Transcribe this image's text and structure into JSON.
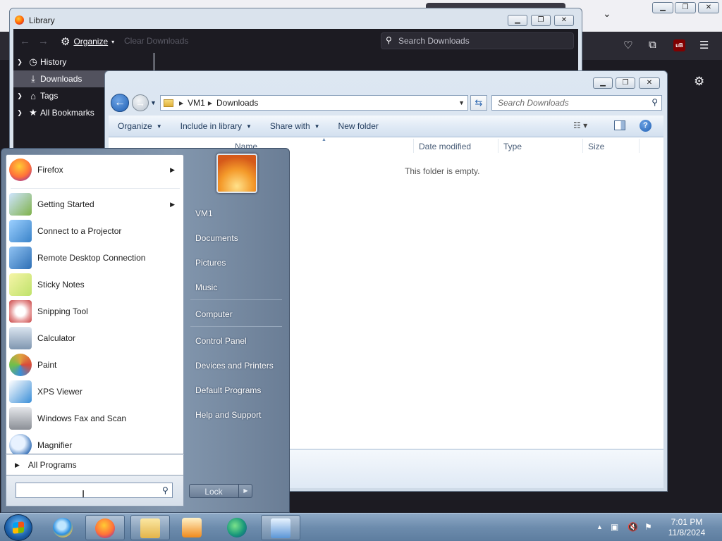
{
  "library": {
    "title": "Library",
    "organize": "Organize",
    "clear_downloads": "Clear Downloads",
    "search_placeholder": "Search Downloads",
    "sidebar": [
      {
        "label": "History",
        "icon": "clock-icon",
        "twisty": "›",
        "selected": false
      },
      {
        "label": "Downloads",
        "icon": "download-icon",
        "twisty": "",
        "selected": true
      },
      {
        "label": "Tags",
        "icon": "tag-icon",
        "twisty": "›",
        "selected": false
      },
      {
        "label": "All Bookmarks",
        "icon": "star-icon",
        "twisty": "›",
        "selected": false
      }
    ]
  },
  "explorer": {
    "address": {
      "root": "VM1",
      "folder": "Downloads"
    },
    "search_placeholder": "Search Downloads",
    "commands": [
      {
        "label": "Organize",
        "dropdown": true
      },
      {
        "label": "Include in library",
        "dropdown": true
      },
      {
        "label": "Share with",
        "dropdown": true
      },
      {
        "label": "New folder",
        "dropdown": false
      }
    ],
    "columns": [
      "Name",
      "Date modified",
      "Type",
      "Size"
    ],
    "empty_message": "This folder is empty."
  },
  "start_menu": {
    "programs": [
      {
        "label": "Firefox",
        "icon": "firefox-icon",
        "submenu": true,
        "color": "#ff7139"
      },
      {
        "label": "Getting Started",
        "icon": "getting-started-icon",
        "submenu": true,
        "color": "#7fb24b"
      },
      {
        "label": "Connect to a Projector",
        "icon": "projector-icon",
        "submenu": false,
        "color": "#3a83c9"
      },
      {
        "label": "Remote Desktop Connection",
        "icon": "remote-desktop-icon",
        "submenu": false,
        "color": "#2e6fb5"
      },
      {
        "label": "Sticky Notes",
        "icon": "sticky-notes-icon",
        "submenu": false,
        "color": "#e6e36a"
      },
      {
        "label": "Snipping Tool",
        "icon": "scissors-icon",
        "submenu": false,
        "color": "#c94646"
      },
      {
        "label": "Calculator",
        "icon": "calculator-icon",
        "submenu": false,
        "color": "#7f96b0"
      },
      {
        "label": "Paint",
        "icon": "paint-icon",
        "submenu": false,
        "color": "#e0a23e"
      },
      {
        "label": "XPS Viewer",
        "icon": "xps-viewer-icon",
        "submenu": false,
        "color": "#3b8fd8"
      },
      {
        "label": "Windows Fax and Scan",
        "icon": "fax-scan-icon",
        "submenu": false,
        "color": "#8b8f96"
      },
      {
        "label": "Magnifier",
        "icon": "magnifier-icon",
        "submenu": false,
        "color": "#4a7fbf"
      }
    ],
    "all_programs": "All Programs",
    "right_links": [
      "VM1",
      "Documents",
      "Pictures",
      "Music",
      "Computer",
      "Control Panel",
      "Devices and Printers",
      "Default Programs",
      "Help and Support"
    ],
    "lock_label": "Lock"
  },
  "taskbar": {
    "time": "7:01 PM",
    "date": "11/8/2024"
  }
}
